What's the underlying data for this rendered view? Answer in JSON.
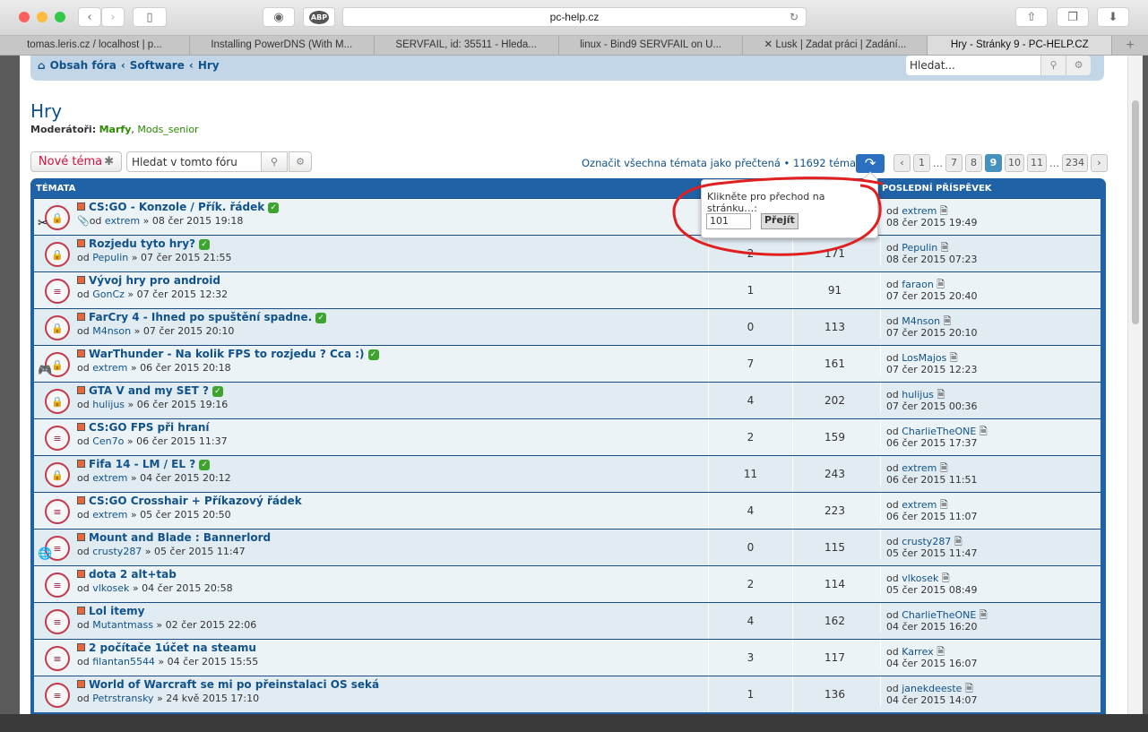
{
  "browser": {
    "url": "pc-help.cz",
    "abp_label": "ABP",
    "tabs": [
      "tomas.leris.cz / localhost | p...",
      "Installing PowerDNS (With M...",
      "SERVFAIL, id: 35511 - Hleda...",
      "linux - Bind9 SERVFAIL on U...",
      "✕ Lusk  | Zadat práci  | Zadání...",
      "Hry - Stránky 9 - PC-HELP.CZ"
    ]
  },
  "breadcrumb": [
    "Obsah fóra",
    "Software",
    "Hry"
  ],
  "search": {
    "placeholder": "Hledat..."
  },
  "forum": {
    "title": "Hry",
    "moderators_label": "Moderátoři:",
    "moderators": [
      "Marfy",
      "Mods_senior"
    ]
  },
  "actions": {
    "new_topic": "Nové téma",
    "forum_search_placeholder": "Hledat v tomto fóru",
    "mark_read": "Označit všechna témata jako přečtená",
    "topic_count": "11692 témat"
  },
  "pagination": {
    "pages": [
      "1",
      "…",
      "7",
      "8",
      "9",
      "10",
      "11",
      "…",
      "234"
    ],
    "current": "9"
  },
  "popup": {
    "prompt": "Klikněte pro přechod na stránku…:",
    "value": "101",
    "go": "Přejít"
  },
  "table": {
    "col_topics": "TÉMATA",
    "col_last": "POSLEDNÍ PŘÍSPĚVEK",
    "rows": [
      {
        "title": "CS:GO - Konzole / Přík. řádek",
        "author": "extrem",
        "date": "08 čer 2015 19:18",
        "replies": "",
        "views": "",
        "last_author": "extrem",
        "last_date": "08 čer 2015 19:49",
        "solved": true,
        "type": "locked",
        "overlay": "tools",
        "attach": true
      },
      {
        "title": "Rozjedu tyto hry?",
        "author": "Pepulin",
        "date": "07 čer 2015 21:55",
        "replies": "2",
        "views": "171",
        "last_author": "Pepulin",
        "last_date": "08 čer 2015 07:23",
        "solved": true,
        "type": "locked"
      },
      {
        "title": "Vývoj hry pro android",
        "author": "GonCz",
        "date": "07 čer 2015 12:32",
        "replies": "1",
        "views": "91",
        "last_author": "faraon",
        "last_date": "07 čer 2015 20:40",
        "solved": false,
        "type": "topic"
      },
      {
        "title": "FarCry 4 - Ihned po spuštění spadne.",
        "author": "M4nson",
        "date": "07 čer 2015 20:10",
        "replies": "0",
        "views": "113",
        "last_author": "M4nson",
        "last_date": "07 čer 2015 20:10",
        "solved": true,
        "type": "locked"
      },
      {
        "title": "WarThunder - Na kolik FPS to rozjedu ? Cca :)",
        "author": "extrem",
        "date": "06 čer 2015 20:18",
        "replies": "7",
        "views": "161",
        "last_author": "LosMajos",
        "last_date": "07 čer 2015 12:23",
        "solved": true,
        "type": "locked",
        "overlay": "gamepad"
      },
      {
        "title": "GTA V and my SET ?",
        "author": "hulijus",
        "date": "06 čer 2015 19:16",
        "replies": "4",
        "views": "202",
        "last_author": "hulijus",
        "last_date": "07 čer 2015 00:36",
        "solved": true,
        "type": "locked"
      },
      {
        "title": "CS:GO FPS při hraní",
        "author": "Cen7o",
        "date": "06 čer 2015 11:37",
        "replies": "2",
        "views": "159",
        "last_author": "CharlieTheONE",
        "last_date": "06 čer 2015 17:37",
        "solved": false,
        "type": "topic"
      },
      {
        "title": "Fifa 14 - LM / EL ?",
        "author": "extrem",
        "date": "04 čer 2015 20:12",
        "replies": "11",
        "views": "243",
        "last_author": "extrem",
        "last_date": "06 čer 2015 11:51",
        "solved": true,
        "type": "locked"
      },
      {
        "title": "CS:GO Crosshair + Příkazový řádek",
        "author": "extrem",
        "date": "05 čer 2015 20:50",
        "replies": "4",
        "views": "223",
        "last_author": "extrem",
        "last_date": "06 čer 2015 11:07",
        "solved": false,
        "type": "topic"
      },
      {
        "title": "Mount and Blade : Bannerlord",
        "author": "crusty287",
        "date": "05 čer 2015 11:47",
        "replies": "0",
        "views": "115",
        "last_author": "crusty287",
        "last_date": "05 čer 2015 11:47",
        "solved": false,
        "type": "topic",
        "overlay": "globe"
      },
      {
        "title": "dota 2 alt+tab",
        "author": "vlkosek",
        "date": "04 čer 2015 20:58",
        "replies": "2",
        "views": "114",
        "last_author": "vlkosek",
        "last_date": "05 čer 2015 08:49",
        "solved": false,
        "type": "topic"
      },
      {
        "title": "Lol itemy",
        "author": "Mutantmass",
        "date": "02 čer 2015 22:06",
        "replies": "4",
        "views": "162",
        "last_author": "CharlieTheONE",
        "last_date": "04 čer 2015 16:20",
        "solved": false,
        "type": "topic"
      },
      {
        "title": "2 počítače 1účet na steamu",
        "author": "filantan5544",
        "date": "04 čer 2015 15:55",
        "replies": "3",
        "views": "117",
        "last_author": "Karrex",
        "last_date": "04 čer 2015 16:07",
        "solved": false,
        "type": "topic"
      },
      {
        "title": "World of Warcraft se mi po přeinstalaci OS seká",
        "author": "Petrstransky",
        "date": "24 kvě 2015 17:10",
        "replies": "1",
        "views": "136",
        "last_author": "janekdeeste",
        "last_date": "04 čer 2015 14:07",
        "solved": false,
        "type": "topic"
      }
    ]
  },
  "colors": {
    "brand": "#105289",
    "header": "#1f63a6",
    "annotation": "#e02020"
  }
}
